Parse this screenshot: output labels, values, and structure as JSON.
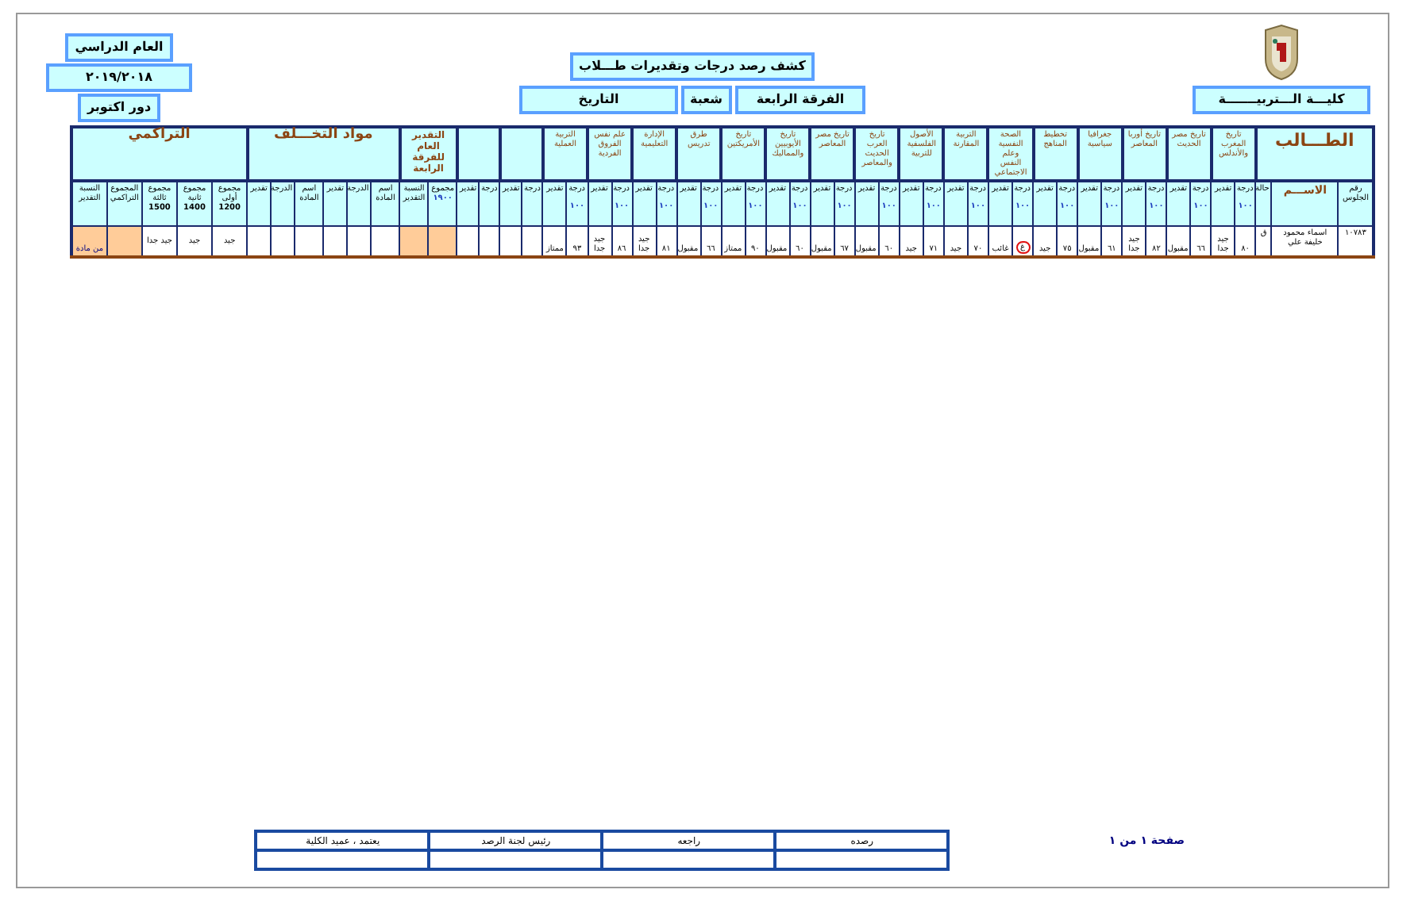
{
  "header": {
    "college": "كليـــة الـــتربيـــــــة",
    "title": "كشف رصد درجات وتقديرات طـــلاب",
    "level": "الفرقة الرابعة",
    "division_label": "شعبة",
    "division": "التاريخ",
    "year_label": "العام الدراسي",
    "year": "٢٠١٩/٢٠١٨",
    "session": "دور اكتوبر"
  },
  "table": {
    "student_group": "الطـــالب",
    "seat_label": "رقم الجلوس",
    "name_label": "الاســـم",
    "status_label": "حالة",
    "subjects": [
      {
        "name": "تاريخ المغرب والأندلس",
        "grade_label": "درجة",
        "max": "١٠٠",
        "rating_label": "تقدير",
        "grade": "٨٠",
        "rating": "جيد جدا",
        "circled": false
      },
      {
        "name": "تاريخ مصر الحديث",
        "grade_label": "درجة",
        "max": "١٠٠",
        "rating_label": "تقدير",
        "grade": "٦٦",
        "rating": "مقبول",
        "circled": false
      },
      {
        "name": "تاريخ أوربا المعاصر",
        "grade_label": "درجة",
        "max": "١٠٠",
        "rating_label": "تقدير",
        "grade": "٨٢",
        "rating": "جيد جدا",
        "circled": false
      },
      {
        "name": "جغرافيا سياسية",
        "grade_label": "درجة",
        "max": "١٠٠",
        "rating_label": "تقدير",
        "grade": "٦١",
        "rating": "مقبول",
        "circled": false
      },
      {
        "name": "تخطيط المناهج",
        "grade_label": "درجة",
        "max": "١٠٠",
        "rating_label": "تقدير",
        "grade": "٧٥",
        "rating": "جيد",
        "circled": false
      },
      {
        "name": "الصحة النفسية وعلم النفس الاجتماعي",
        "grade_label": "درجة",
        "max": "١٠٠",
        "rating_label": "تقدير",
        "grade": "غ",
        "rating": "غائب",
        "circled": true
      },
      {
        "name": "التربية المقارنة",
        "grade_label": "درجة",
        "max": "١٠٠",
        "rating_label": "تقدير",
        "grade": "٧٠",
        "rating": "جيد",
        "circled": false
      },
      {
        "name": "الأصول الفلسفية للتربية",
        "grade_label": "درجة",
        "max": "١٠٠",
        "rating_label": "تقدير",
        "grade": "٧١",
        "rating": "جيد",
        "circled": false
      },
      {
        "name": "تاريخ العرب الحديث والمعاصر",
        "grade_label": "درجة",
        "max": "١٠٠",
        "rating_label": "تقدير",
        "grade": "٦٠",
        "rating": "مقبول",
        "circled": false
      },
      {
        "name": "تاريخ مصر المعاصر",
        "grade_label": "درجة",
        "max": "١٠٠",
        "rating_label": "تقدير",
        "grade": "٦٧",
        "rating": "مقبول",
        "circled": false
      },
      {
        "name": "تاريخ الأيوبيين والمماليك",
        "grade_label": "درجة",
        "max": "١٠٠",
        "rating_label": "تقدير",
        "grade": "٦٠",
        "rating": "مقبول",
        "circled": false
      },
      {
        "name": "تاريخ الأمريكتين",
        "grade_label": "درجة",
        "max": "١٠٠",
        "rating_label": "تقدير",
        "grade": "٩٠",
        "rating": "ممتاز",
        "circled": false
      },
      {
        "name": "طرق تدريس",
        "grade_label": "درجة",
        "max": "١٠٠",
        "rating_label": "تقدير",
        "grade": "٦٦",
        "rating": "مقبول",
        "circled": false
      },
      {
        "name": "الإدارة التعليمية",
        "grade_label": "درجة",
        "max": "١٠٠",
        "rating_label": "تقدير",
        "grade": "٨١",
        "rating": "جيد جدا",
        "circled": false
      },
      {
        "name": "علم نفس الفروق الفردية",
        "grade_label": "درجة",
        "max": "١٠٠",
        "rating_label": "تقدير",
        "grade": "٨٦",
        "rating": "جيد جدا",
        "circled": false
      },
      {
        "name": "التربية العملية",
        "grade_label": "درجة",
        "max": "١٠٠",
        "rating_label": "تقدير",
        "grade": "٩٣",
        "rating": "ممتاز",
        "circled": false
      }
    ],
    "blank_subjects": [
      {
        "grade_label": "درجة",
        "rating_label": "تقدير"
      },
      {
        "grade_label": "درجة",
        "rating_label": "تقدير"
      }
    ],
    "general": {
      "title": "التقدير العام للفرقة الرابعة",
      "total_label": "مجموع",
      "total_max": "١٩٠٠",
      "percent_label": "النسبة التقدير"
    },
    "makeup": {
      "title": "مواد التخـــلف",
      "columns": [
        "اسم المادة",
        "الدرجة",
        "تقدير",
        "اسم المادة",
        "الدرجة",
        "تقدير"
      ]
    },
    "cumulative": {
      "title": "التراكمي",
      "columns": [
        {
          "label": "مجموع أولى",
          "max": "1200",
          "value": "جيد"
        },
        {
          "label": "مجموع ثانية",
          "max": "1400",
          "value": "جيد"
        },
        {
          "label": "مجموع ثالثة",
          "max": "1500",
          "value": "جيد جدا"
        }
      ],
      "total_label": "المجموع التراكمي",
      "percent_label": "النسبة التقدير",
      "percent_value": "من مادة"
    },
    "row": {
      "seat": "١٠٧٨٣",
      "name": "اسماء محمود خليفة علي",
      "status": "ق"
    }
  },
  "footer": {
    "page": "صفحة ١ من ١",
    "signatures": [
      "رصده",
      "راجعه",
      "رئيس لجنة الرصد",
      "يعتمد ، عميد الكلية"
    ]
  }
}
